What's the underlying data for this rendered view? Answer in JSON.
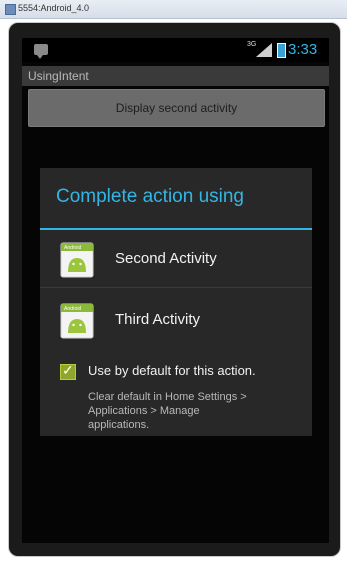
{
  "window": {
    "title": "5554:Android_4.0"
  },
  "status_bar": {
    "notification_icon": "notification-icon",
    "signal_label": "3G",
    "time": "3:33",
    "accent_color": "#33b5e5"
  },
  "app": {
    "title": "UsingIntent",
    "button_label": "Display second activity"
  },
  "dialog": {
    "title": "Complete action using",
    "options": [
      {
        "label": "Second Activity",
        "icon": "android-app-icon",
        "icon_caption": "Android"
      },
      {
        "label": "Third Activity",
        "icon": "android-app-icon",
        "icon_caption": "Android"
      }
    ],
    "default_checkbox": {
      "label": "Use by default for this action.",
      "checked": true
    },
    "hint": "Clear default in Home Settings >\nApplications > Manage\napplications."
  }
}
